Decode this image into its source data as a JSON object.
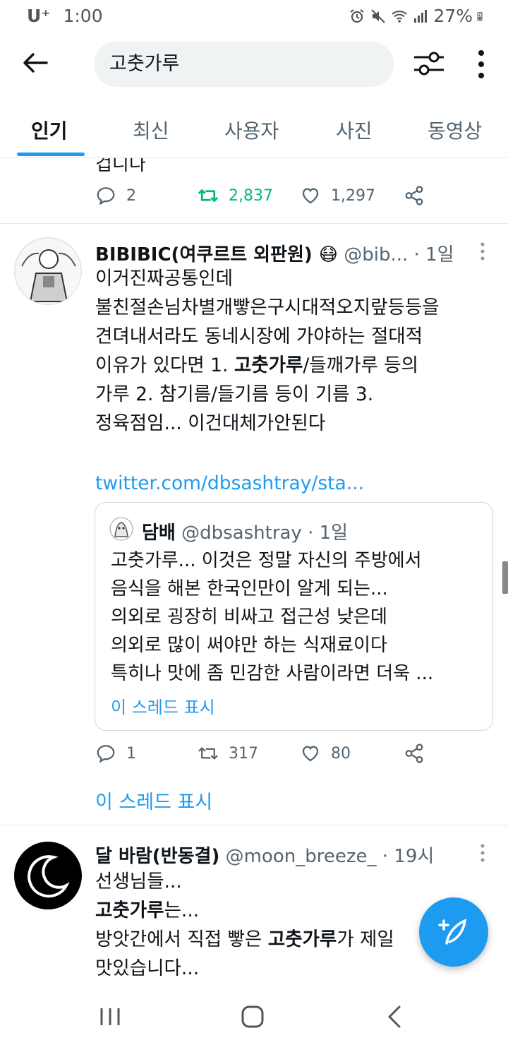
{
  "status_bar": {
    "carrier": "U⁺",
    "time": "1:00",
    "battery": "27%"
  },
  "search": {
    "query": "고춧가루"
  },
  "tabs": [
    {
      "label": "인기"
    },
    {
      "label": "최신"
    },
    {
      "label": "사용자"
    },
    {
      "label": "사진"
    },
    {
      "label": "동영상"
    }
  ],
  "tweet0": {
    "tail_text": "겁니다",
    "replies": "2",
    "retweets": "2,837",
    "likes": "1,297"
  },
  "tweet1": {
    "name": "BIBIBIC(여쿠르트 외판원) 😷",
    "handle": "@bib...",
    "time": "· 1일",
    "lines": [
      "이거진짜공통인데",
      "불친절손님차별개빻은구시대적오지랖등등을",
      "견뎌내서라도 동네시장에 가야하는 절대적",
      "이유가 있다면 1. ",
      "고춧가루",
      "/들깨가루 등의",
      "가루 2. 참기름/들기름 등이 기름 3.",
      "정육점임... 이건대체가안된다"
    ],
    "link": "twitter.com/dbsashtray/sta...",
    "quote": {
      "name": "담배",
      "handle": "@dbsashtray",
      "time": "· 1일",
      "lines": [
        "고춧가루... 이것은 정말 자신의 주방에서",
        "음식을 해본 한국인만이 알게 되는...",
        "의외로 굉장히 비싸고 접근성 낮은데",
        "의외로 많이 써야만 하는 식재료이다",
        "특히나 맛에 좀 민감한 사람이라면 더욱 ..."
      ],
      "thread": "이 스레드 표시"
    },
    "replies": "1",
    "retweets": "317",
    "likes": "80",
    "thread": "이 스레드 표시"
  },
  "tweet2": {
    "name": "달 바람(반동결)",
    "handle": "@moon_breeze_",
    "time": "· 19시",
    "line1": "선생님들...",
    "line2_bold": "고춧가루",
    "line2_rest": "는...",
    "line3_a": "방앗간에서 직접 빻은 ",
    "line3_bold": "고춧가루",
    "line3_b": "가 제일",
    "line4": "맛있습니다..."
  },
  "colors": {
    "accent": "#1d9bf0",
    "retweet_green": "#00ba7c",
    "secondary": "#536471"
  }
}
